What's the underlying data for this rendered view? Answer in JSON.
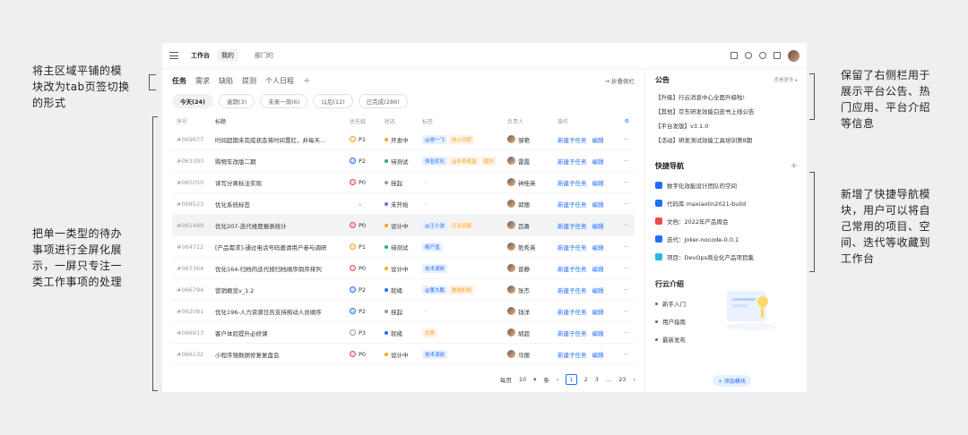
{
  "annotations": {
    "left_top": [
      "将主区域平铺的模",
      "块改为tab页签切换",
      "的形式"
    ],
    "left_bottom": [
      "把单一类型的待办",
      "事项进行全屏化展",
      "示，一屏只专注一",
      "类工作事项的处理"
    ],
    "right_top": [
      "保留了右侧栏用于",
      "展示平台公告、热",
      "门应用、平台介绍",
      "等信息"
    ],
    "right_bottom": [
      "新增了快捷导航模",
      "块，用户可以将自",
      "己常用的项目、空",
      "间、迭代等收藏到",
      "工作台"
    ]
  },
  "topbar": {
    "tabs": [
      "工作台",
      "我的",
      "部门的"
    ]
  },
  "main": {
    "tabs": [
      "任务",
      "需求",
      "缺陷",
      "提测",
      "个人日程"
    ],
    "plus": "+",
    "collapse": "⇥ 折叠侧栏",
    "filters": [
      "今天(24)",
      "逾期(3)",
      "未来一周(6)",
      "以后(12)",
      "已完成(286)"
    ],
    "headers": [
      "序号",
      "标题",
      "优先级",
      "状态",
      "标签",
      "负责人",
      "操作"
    ],
    "rows": [
      {
        "id": "#069677",
        "title": "时间超期未完成状态将时间置红，并每天...",
        "pri": "P1",
        "pc": "#f5a623",
        "status": "开发中",
        "sc": "#f5a623",
        "tags": [
          [
            "@谢一飞",
            "#e8f0ff",
            "#1f6fff"
          ],
          [
            "线上问题",
            "#fff1e6",
            "#f5a623"
          ]
        ],
        "user": "邹艳",
        "ops": [
          "新建子任务",
          "编辑"
        ],
        "more": "···"
      },
      {
        "id": "#063393",
        "title": "购物车改版二期",
        "pri": "P2",
        "pc": "#1f6fff",
        "status": "待测试",
        "sc": "#19b36b",
        "tags": [
          [
            "体验优化",
            "#e8f0ff",
            "#1f6fff"
          ],
          [
            "@业务收益",
            "#fff1e6",
            "#f5a623"
          ],
          [
            "爆炸",
            "#fff1e6",
            "#f5a623"
          ]
        ],
        "user": "雷霞",
        "ops": [
          "新建子任务",
          "编辑"
        ],
        "more": "···"
      },
      {
        "id": "#065050",
        "title": "读写分离标注实现",
        "pri": "P0",
        "pc": "#f04848",
        "status": "挂起",
        "sc": "#999",
        "tags": [
          [
            "–",
            "#fff",
            "#999"
          ]
        ],
        "user": "钟桂英",
        "ops": [
          "新建子任务",
          "编辑"
        ],
        "more": "···"
      },
      {
        "id": "#068523",
        "title": "优化系统标签",
        "pri": "–",
        "pc": "#fff",
        "status": "未开始",
        "sc": "#8a63d2",
        "tags": [
          [
            "–",
            "#fff",
            "#999"
          ]
        ],
        "user": "郭丽",
        "ops": [
          "新建子任务",
          "编辑"
        ],
        "more": "···"
      },
      {
        "id": "#061489",
        "title": "优化207-迭代维度报表统计",
        "pri": "P0",
        "pc": "#f04848",
        "status": "设计中",
        "sc": "#f5a623",
        "tags": [
          [
            "@王小波",
            "#e8f0ff",
            "#1f6fff"
          ],
          [
            "迁关低额",
            "#fff1e6",
            "#f5a623"
          ]
        ],
        "user": "吕勇",
        "ops": [
          "新建子任务",
          "编辑"
        ],
        "more": "···",
        "hl": true
      },
      {
        "id": "#064712",
        "title": "[产品需求]-通过电话号码邀请用户参与调研",
        "pri": "P1",
        "pc": "#f5a623",
        "status": "待测试",
        "sc": "#19b36b",
        "tags": [
          [
            "精产值",
            "#e8f0ff",
            "#1f6fff"
          ]
        ],
        "user": "熊秀英",
        "ops": [
          "新建子任务",
          "编辑"
        ],
        "more": "···"
      },
      {
        "id": "#067364",
        "title": "优化164-归档的迭代按归档顺序倒序排列",
        "pri": "P0",
        "pc": "#f04848",
        "status": "设计中",
        "sc": "#f5a623",
        "tags": [
          [
            "技术调研",
            "#e8f0ff",
            "#1f6fff"
          ]
        ],
        "user": "曾静",
        "ops": [
          "新建子任务",
          "编辑"
        ],
        "more": "···"
      },
      {
        "id": "#066794",
        "title": "营销概览v_1.2",
        "pri": "P2",
        "pc": "#1f6fff",
        "status": "就绪",
        "sc": "#1f6fff",
        "tags": [
          [
            "@董大鹏",
            "#e8f0ff",
            "#1f6fff"
          ],
          [
            "数据机制",
            "#fff1e6",
            "#f5a623"
          ]
        ],
        "user": "张杰",
        "ops": [
          "新建子任务",
          "编辑"
        ],
        "more": "···"
      },
      {
        "id": "#062081",
        "title": "优化196-人力资源日历支持拖动人员顺序",
        "pri": "P2",
        "pc": "#1f6fff",
        "status": "挂起",
        "sc": "#999",
        "tags": [
          [
            "–",
            "#fff",
            "#999"
          ]
        ],
        "user": "钱洋",
        "ops": [
          "新建子任务",
          "编辑"
        ],
        "more": "···"
      },
      {
        "id": "#066913",
        "title": "客户体验提升必修课",
        "pri": "P3",
        "pc": "#999",
        "status": "就绪",
        "sc": "#1f6fff",
        "tags": [
          [
            "优秀",
            "#fff1e6",
            "#f5a623"
          ]
        ],
        "user": "胡超",
        "ops": [
          "新建子任务",
          "编辑"
        ],
        "more": "···"
      },
      {
        "id": "#066132",
        "title": "小程序强数据修复复盘会",
        "pri": "P0",
        "pc": "#f04848",
        "status": "设计中",
        "sc": "#f5a623",
        "tags": [
          [
            "技术调研",
            "#e8f0ff",
            "#1f6fff"
          ]
        ],
        "user": "马丽",
        "ops": [
          "新建子任务",
          "编辑"
        ],
        "more": "···"
      }
    ],
    "pager": {
      "per_page_label": "每页",
      "per_page": "10",
      "unit": "条",
      "pages": [
        "1",
        "2",
        "3",
        "...",
        "23"
      ]
    }
  },
  "side": {
    "notice_title": "公告",
    "notice_more": "查看更多 ▸",
    "notices": [
      "【升级】行云消息中心全面升级啦!",
      "【其他】京东研发效能白皮书上线公告",
      "【平台发版】v3.1.0",
      "【活动】研发测试效能工具培训第8期"
    ],
    "nav_title": "快捷导航",
    "nav_plus": "+",
    "navs": [
      "数字化效能设计团队的空间",
      "代码库 maxiaolin2021-build",
      "文档：2022年产品周会",
      "迭代：Joker-nocode-0.0.1",
      "项目：DevOps商业化产品项目集"
    ],
    "intro_title": "行云介绍",
    "intros": [
      "新手入门",
      "用户指南",
      "最新发布"
    ],
    "add_module": "+ 添加模块"
  },
  "colors": {
    "accent": "#1f6fff",
    "bg": "#efeff2"
  }
}
